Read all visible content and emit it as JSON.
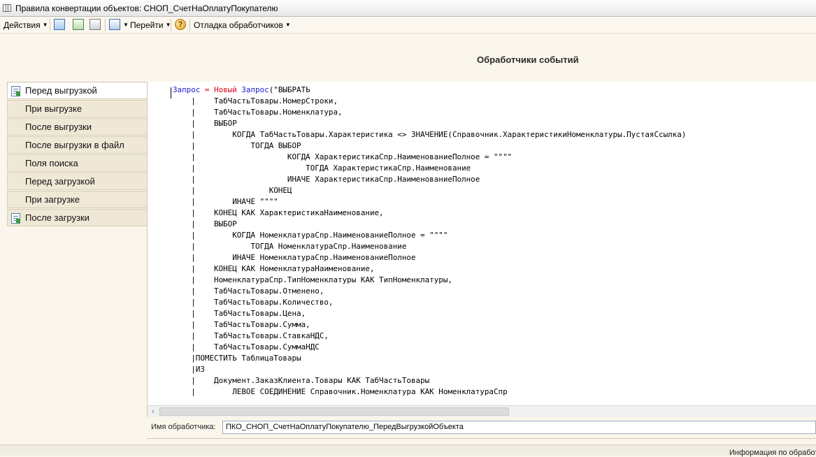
{
  "window": {
    "title": "Правила конвертации объектов: СНОП_СчетНаОплатуПокупателю"
  },
  "toolbar": {
    "actions_label": "Действия",
    "go_label": "Перейти",
    "debug_label": "Отладка обработчиков",
    "help_icon_text": "?"
  },
  "header": {
    "title": "Обработчики событий"
  },
  "tabs": [
    {
      "label": "Перед выгрузкой",
      "active": true,
      "has_icon": true
    },
    {
      "label": "При выгрузке",
      "active": false,
      "has_icon": false
    },
    {
      "label": "После выгрузки",
      "active": false,
      "has_icon": false
    },
    {
      "label": "После выгрузки в файл",
      "active": false,
      "has_icon": false
    },
    {
      "label": "Поля поиска",
      "active": false,
      "has_icon": false
    },
    {
      "label": "Перед загрузкой",
      "active": false,
      "has_icon": false
    },
    {
      "label": "При загрузке",
      "active": false,
      "has_icon": false
    },
    {
      "label": "После загрузки",
      "active": false,
      "has_icon": true
    }
  ],
  "editor": {
    "first_line": {
      "var": "Запрос",
      "eq": " = ",
      "new_kw": "Новый",
      "type": "Запрос",
      "rest": "(\"ВЫБРАТЬ"
    },
    "lines": [
      "    |    ТабЧастьТовары.НомерСтроки,",
      "    |    ТабЧастьТовары.Номенклатура,",
      "    |    ВЫБОР",
      "    |        КОГДА ТабЧастьТовары.Характеристика <> ЗНАЧЕНИЕ(Справочник.ХарактеристикиНоменклатуры.ПустаяСсылка)",
      "    |            ТОГДА ВЫБОР",
      "    |                    КОГДА ХарактеристикаСпр.НаименованиеПолное = \"\"\"\"",
      "    |                        ТОГДА ХарактеристикаСпр.Наименование",
      "    |                    ИНАЧЕ ХарактеристикаСпр.НаименованиеПолное",
      "    |                КОНЕЦ",
      "    |        ИНАЧЕ \"\"\"\"",
      "    |    КОНЕЦ КАК ХарактеристикаНаименование,",
      "    |    ВЫБОР",
      "    |        КОГДА НоменклатураСпр.НаименованиеПолное = \"\"\"\"",
      "    |            ТОГДА НоменклатураСпр.Наименование",
      "    |        ИНАЧЕ НоменклатураСпр.НаименованиеПолное",
      "    |    КОНЕЦ КАК НоменклатураНаименование,",
      "    |    НоменклатураСпр.ТипНоменклатуры КАК ТипНоменклатуры,",
      "    |    ТабЧастьТовары.Отменено,",
      "    |    ТабЧастьТовары.Количество,",
      "    |    ТабЧастьТовары.Цена,",
      "    |    ТабЧастьТовары.Сумма,",
      "    |    ТабЧастьТовары.СтавкаНДС,",
      "    |    ТабЧастьТовары.СуммаНДС",
      "    |ПОМЕСТИТЬ ТаблицаТовары",
      "    |ИЗ",
      "    |    Документ.ЗаказКлиента.Товары КАК ТабЧастьТовары",
      "    |        ЛЕВОЕ СОЕДИНЕНИЕ Справочник.Номенклатура КАК НоменклатураСпр"
    ]
  },
  "handler": {
    "label": "Имя обработчика:",
    "value": "ПКО_СНОП_СчетНаОплатуПокупателю_ПередВыгрузкойОбъекта"
  },
  "status": {
    "text": "Информация по обработ"
  },
  "colors": {
    "keyword_blue": "#1a1acc",
    "keyword_red": "#e0001b",
    "background": "#fbf6ec"
  }
}
